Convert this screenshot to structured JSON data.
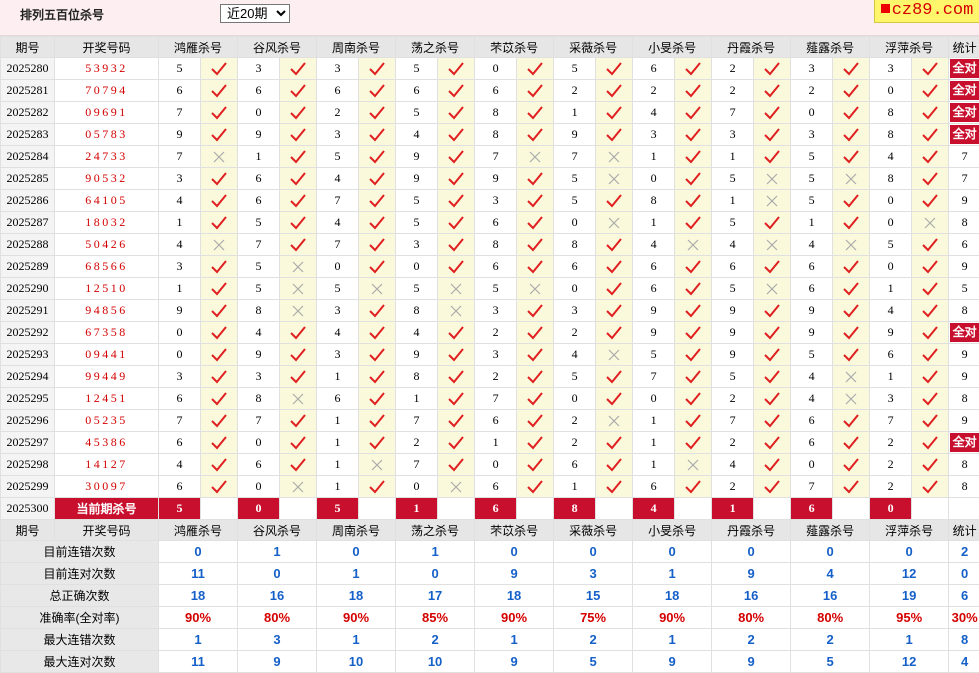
{
  "page_title": "排列五百位杀号",
  "period_select": {
    "selected": "近20期"
  },
  "logo_text": "cz89.com",
  "colors": {
    "accent_red": "#c8102e",
    "check_red": "#e02020",
    "stat_blue": "#1560c8",
    "mark_bg": "#fbf9dc"
  },
  "headers": {
    "period": "期号",
    "winning": "开奖号码",
    "stats": "统计",
    "experts": [
      "鸿雁杀号",
      "谷风杀号",
      "周南杀号",
      "荡之杀号",
      "芣苡杀号",
      "采薇杀号",
      "小旻杀号",
      "丹霞杀号",
      "薤露杀号",
      "浮萍杀号"
    ]
  },
  "all_correct_label": "全对",
  "rows": [
    {
      "p": "2025280",
      "n": "53932",
      "k": [
        5,
        3,
        3,
        5,
        0,
        5,
        6,
        2,
        3,
        3
      ],
      "c": [
        1,
        1,
        1,
        1,
        1,
        1,
        1,
        1,
        1,
        1
      ],
      "s": "全对"
    },
    {
      "p": "2025281",
      "n": "70794",
      "k": [
        6,
        6,
        6,
        6,
        6,
        2,
        2,
        2,
        2,
        0
      ],
      "c": [
        1,
        1,
        1,
        1,
        1,
        1,
        1,
        1,
        1,
        1
      ],
      "s": "全对"
    },
    {
      "p": "2025282",
      "n": "09691",
      "k": [
        7,
        0,
        2,
        5,
        8,
        1,
        4,
        7,
        0,
        8
      ],
      "c": [
        1,
        1,
        1,
        1,
        1,
        1,
        1,
        1,
        1,
        1
      ],
      "s": "全对"
    },
    {
      "p": "2025283",
      "n": "05783",
      "k": [
        9,
        9,
        3,
        4,
        8,
        9,
        3,
        3,
        3,
        8
      ],
      "c": [
        1,
        1,
        1,
        1,
        1,
        1,
        1,
        1,
        1,
        1
      ],
      "s": "全对"
    },
    {
      "p": "2025284",
      "n": "24733",
      "k": [
        7,
        1,
        5,
        9,
        7,
        7,
        1,
        1,
        5,
        4
      ],
      "c": [
        0,
        1,
        1,
        1,
        0,
        0,
        1,
        1,
        1,
        1
      ],
      "s": "7"
    },
    {
      "p": "2025285",
      "n": "90532",
      "k": [
        3,
        6,
        4,
        9,
        9,
        5,
        0,
        5,
        5,
        8
      ],
      "c": [
        1,
        1,
        1,
        1,
        1,
        0,
        1,
        0,
        0,
        1
      ],
      "s": "7"
    },
    {
      "p": "2025286",
      "n": "64105",
      "k": [
        4,
        6,
        7,
        5,
        3,
        5,
        8,
        1,
        5,
        0
      ],
      "c": [
        1,
        1,
        1,
        1,
        1,
        1,
        1,
        0,
        1,
        1
      ],
      "s": "9"
    },
    {
      "p": "2025287",
      "n": "18032",
      "k": [
        1,
        5,
        4,
        5,
        6,
        0,
        1,
        5,
        1,
        0
      ],
      "c": [
        1,
        1,
        1,
        1,
        1,
        0,
        1,
        1,
        1,
        0
      ],
      "s": "8"
    },
    {
      "p": "2025288",
      "n": "50426",
      "k": [
        4,
        7,
        7,
        3,
        8,
        8,
        4,
        4,
        4,
        5
      ],
      "c": [
        0,
        1,
        1,
        1,
        1,
        1,
        0,
        0,
        0,
        1
      ],
      "s": "6"
    },
    {
      "p": "2025289",
      "n": "68566",
      "k": [
        3,
        5,
        0,
        0,
        6,
        6,
        6,
        6,
        6,
        0
      ],
      "c": [
        1,
        0,
        1,
        1,
        1,
        1,
        1,
        1,
        1,
        1
      ],
      "s": "9"
    },
    {
      "p": "2025290",
      "n": "12510",
      "k": [
        1,
        5,
        5,
        5,
        5,
        0,
        6,
        5,
        6,
        1
      ],
      "c": [
        1,
        0,
        0,
        0,
        0,
        1,
        1,
        0,
        1,
        1
      ],
      "s": "5"
    },
    {
      "p": "2025291",
      "n": "94856",
      "k": [
        9,
        8,
        3,
        8,
        3,
        3,
        9,
        9,
        9,
        4
      ],
      "c": [
        1,
        0,
        1,
        0,
        1,
        1,
        1,
        1,
        1,
        1
      ],
      "s": "8"
    },
    {
      "p": "2025292",
      "n": "67358",
      "k": [
        0,
        4,
        4,
        4,
        2,
        2,
        9,
        9,
        9,
        9
      ],
      "c": [
        1,
        1,
        1,
        1,
        1,
        1,
        1,
        1,
        1,
        1
      ],
      "s": "全对"
    },
    {
      "p": "2025293",
      "n": "09441",
      "k": [
        0,
        9,
        3,
        9,
        3,
        4,
        5,
        9,
        5,
        6
      ],
      "c": [
        1,
        1,
        1,
        1,
        1,
        0,
        1,
        1,
        1,
        1
      ],
      "s": "9"
    },
    {
      "p": "2025294",
      "n": "99449",
      "k": [
        3,
        3,
        1,
        8,
        2,
        5,
        7,
        5,
        4,
        1
      ],
      "c": [
        1,
        1,
        1,
        1,
        1,
        1,
        1,
        1,
        0,
        1
      ],
      "s": "9"
    },
    {
      "p": "2025295",
      "n": "12451",
      "k": [
        6,
        8,
        6,
        1,
        7,
        0,
        0,
        2,
        4,
        3
      ],
      "c": [
        1,
        0,
        1,
        1,
        1,
        1,
        1,
        1,
        0,
        1
      ],
      "s": "8"
    },
    {
      "p": "2025296",
      "n": "05235",
      "k": [
        7,
        7,
        1,
        7,
        6,
        2,
        1,
        7,
        6,
        7
      ],
      "c": [
        1,
        1,
        1,
        1,
        1,
        0,
        1,
        1,
        1,
        1
      ],
      "s": "9"
    },
    {
      "p": "2025297",
      "n": "45386",
      "k": [
        6,
        0,
        1,
        2,
        1,
        2,
        1,
        2,
        6,
        2
      ],
      "c": [
        1,
        1,
        1,
        1,
        1,
        1,
        1,
        1,
        1,
        1
      ],
      "s": "全对"
    },
    {
      "p": "2025298",
      "n": "14127",
      "k": [
        4,
        6,
        1,
        7,
        0,
        6,
        1,
        4,
        0,
        2
      ],
      "c": [
        1,
        1,
        0,
        1,
        1,
        1,
        0,
        1,
        1,
        1
      ],
      "s": "8"
    },
    {
      "p": "2025299",
      "n": "30097",
      "k": [
        6,
        0,
        1,
        0,
        6,
        1,
        6,
        2,
        7,
        2
      ],
      "c": [
        1,
        0,
        1,
        0,
        1,
        1,
        1,
        1,
        1,
        1
      ],
      "s": "8"
    }
  ],
  "current": {
    "period": "2025300",
    "label": "当前期杀号",
    "kills": [
      5,
      0,
      5,
      1,
      6,
      8,
      4,
      1,
      6,
      0
    ]
  },
  "stats_header": {
    "period": "期号",
    "winning": "开奖号码"
  },
  "stats": [
    {
      "label": "目前连错次数",
      "values": [
        "0",
        "1",
        "0",
        "1",
        "0",
        "0",
        "0",
        "0",
        "0",
        "0"
      ],
      "total": "2",
      "kind": "num"
    },
    {
      "label": "目前连对次数",
      "values": [
        "11",
        "0",
        "1",
        "0",
        "9",
        "3",
        "1",
        "9",
        "4",
        "12"
      ],
      "total": "0",
      "kind": "num"
    },
    {
      "label": "总正确次数",
      "values": [
        "18",
        "16",
        "18",
        "17",
        "18",
        "15",
        "18",
        "16",
        "16",
        "19"
      ],
      "total": "6",
      "kind": "num"
    },
    {
      "label": "准确率(全对率)",
      "values": [
        "90%",
        "80%",
        "90%",
        "85%",
        "90%",
        "75%",
        "90%",
        "80%",
        "80%",
        "95%"
      ],
      "total": "30%",
      "kind": "rate"
    },
    {
      "label": "最大连错次数",
      "values": [
        "1",
        "3",
        "1",
        "2",
        "1",
        "2",
        "1",
        "2",
        "2",
        "1"
      ],
      "total": "8",
      "kind": "num"
    },
    {
      "label": "最大连对次数",
      "values": [
        "11",
        "9",
        "10",
        "10",
        "9",
        "5",
        "9",
        "9",
        "5",
        "12"
      ],
      "total": "4",
      "kind": "num"
    }
  ]
}
